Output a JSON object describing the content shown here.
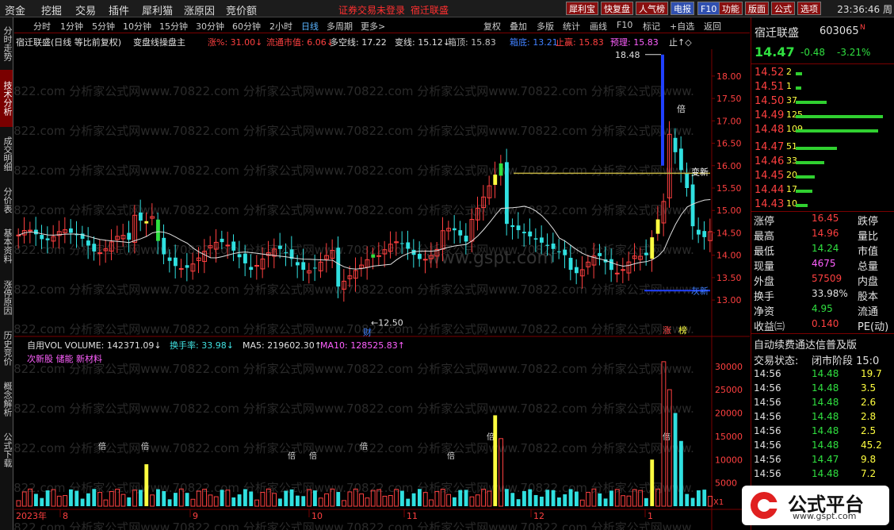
{
  "menubar": {
    "items": [
      "资金",
      "挖掘",
      "交易",
      "插件",
      "犀利猫",
      "涨原因",
      "竞价额"
    ],
    "notice": "证券交易未登录",
    "stock_name": "宿迁联盛",
    "buttons": [
      "犀利宝",
      "快复盘",
      "人气榜",
      "电报",
      "F10",
      "功能",
      "版面",
      "公式",
      "选项"
    ],
    "clock": "23:36:46 周"
  },
  "left_tabs": [
    "分时走势",
    "技术分析",
    "成交明细",
    "分价表",
    "基本资料",
    "涨停原因",
    "历史竞价",
    "概念解析",
    "公式下载"
  ],
  "period_bar": {
    "periods": [
      "分时",
      "1分钟",
      "5分钟",
      "10分钟",
      "15分钟",
      "30分钟",
      "60分钟",
      "2小时",
      "日线",
      "多周期",
      "更多>"
    ],
    "right_buttons": [
      "复权",
      "叠加",
      "多版",
      "统计",
      "画线",
      "F10",
      "标记",
      "+自选",
      "返回"
    ]
  },
  "indicator_bar": {
    "title": "宿迁联盛(日线 等比前复权)",
    "formula": "变盘线操盘主",
    "items": [
      {
        "label": "涨%: 31.00↓",
        "color": "#ff4040"
      },
      {
        "label": "流通市值: 6.06↓",
        "color": "#ff4040"
      },
      {
        "label": "多空线: 17.22",
        "color": "#e0e0e0"
      },
      {
        "label": "变线: 15.12↓",
        "color": "#e0e0e0"
      },
      {
        "label": "箱顶: 15.83",
        "color": "#c0c0c0"
      },
      {
        "label": "箱底: 13.21",
        "color": "#4080ff"
      },
      {
        "label": "止赢: 15.83",
        "color": "#ff4040"
      },
      {
        "label": "预理: 15.83",
        "color": "#ff60ff"
      },
      {
        "label": "止↑◇",
        "color": "#e0e0e0"
      }
    ]
  },
  "price_axis": {
    "ticks": [
      "18.00",
      "17.50",
      "17.00",
      "16.50",
      "16.00",
      "15.50",
      "15.00",
      "14.50",
      "14.00",
      "13.50",
      "13.00"
    ],
    "min": 12.4,
    "max": 18.6
  },
  "price_annotations": {
    "high": "18.48",
    "low": "12.50",
    "bei": "倍",
    "top_label": "变新",
    "bottom_label": "灰新",
    "cai": "财",
    "zhang": "涨",
    "bang": "榜"
  },
  "watermark": "70822.com 分析家公式网www.70822.com 分析家公式网www.70822.com 分析家公式网www.70822.com 分析家公式网www.",
  "watermark2": "www.gspt.com",
  "volume_bar": {
    "items": [
      {
        "label": "自用VOL VOLUME: 142371.09↓",
        "color": "#e0e0e0"
      },
      {
        "label": "换手率: 33.98↓",
        "color": "#40e0e0"
      },
      {
        "label": "MA5: 219602.30↑",
        "color": "#e0e0e0"
      },
      {
        "label": "MA10: 128525.83↑",
        "color": "#ff60ff"
      }
    ],
    "tags": "次新股 储能 新材料",
    "ticks": [
      "30000",
      "25000",
      "20000",
      "15000",
      "10000",
      "5000"
    ],
    "unit": "X1",
    "bei": "倍"
  },
  "date_axis": {
    "labels": [
      "2023年",
      "8",
      "9",
      "10",
      "11",
      "12",
      "1"
    ]
  },
  "quote": {
    "name": "宿迁联盛",
    "code": "603065",
    "code_suffix": "N",
    "price": "14.47",
    "change": "-0.48",
    "pct": "-3.21%",
    "asks": [
      {
        "p": "14.52",
        "v": "2"
      },
      {
        "p": "14.51",
        "v": "1"
      },
      {
        "p": "14.50",
        "v": "37"
      },
      {
        "p": "14.49",
        "v": "125"
      },
      {
        "p": "14.48",
        "v": "109"
      }
    ],
    "bids": [
      {
        "p": "14.47",
        "v": "51"
      },
      {
        "p": "14.46",
        "v": "33"
      },
      {
        "p": "14.45",
        "v": "20"
      },
      {
        "p": "14.44",
        "v": "17"
      },
      {
        "p": "14.43",
        "v": "10"
      }
    ],
    "stats": [
      [
        "涨停",
        "16.45",
        "跌停"
      ],
      [
        "最高",
        "14.96",
        "量比"
      ],
      [
        "最低",
        "14.24",
        "市值"
      ],
      [
        "现量",
        "4675",
        "总量"
      ],
      [
        "外盘",
        "57509",
        "内盘"
      ],
      [
        "换手",
        "33.98%",
        "股本"
      ],
      [
        "净资",
        "4.95",
        "流通"
      ],
      [
        "收益㈢",
        "0.140",
        "PE(动)"
      ]
    ],
    "banner": "自动续费通达信普及版",
    "status_label": "交易状态:",
    "status_value": "闭市阶段 15:0",
    "ticks": [
      {
        "t": "14:56",
        "p": "14.48",
        "v": "19.7"
      },
      {
        "t": "14:56",
        "p": "14.48",
        "v": "3.5"
      },
      {
        "t": "14:56",
        "p": "14.48",
        "v": "2.6"
      },
      {
        "t": "14:56",
        "p": "14.48",
        "v": "2.8"
      },
      {
        "t": "14:56",
        "p": "14.48",
        "v": "2.5"
      },
      {
        "t": "14:56",
        "p": "14.48",
        "v": "45.2"
      },
      {
        "t": "14:56",
        "p": "14.47",
        "v": "9.8"
      },
      {
        "t": "14:56",
        "p": "14.48",
        "v": "7.2"
      }
    ]
  },
  "logo": {
    "text": "公式平台",
    "url": "www.gspt.com"
  },
  "colors": {
    "up": "#ff4040",
    "down": "#30e0e0",
    "ma": "#e0e0e0",
    "accent": "#7a0000"
  }
}
